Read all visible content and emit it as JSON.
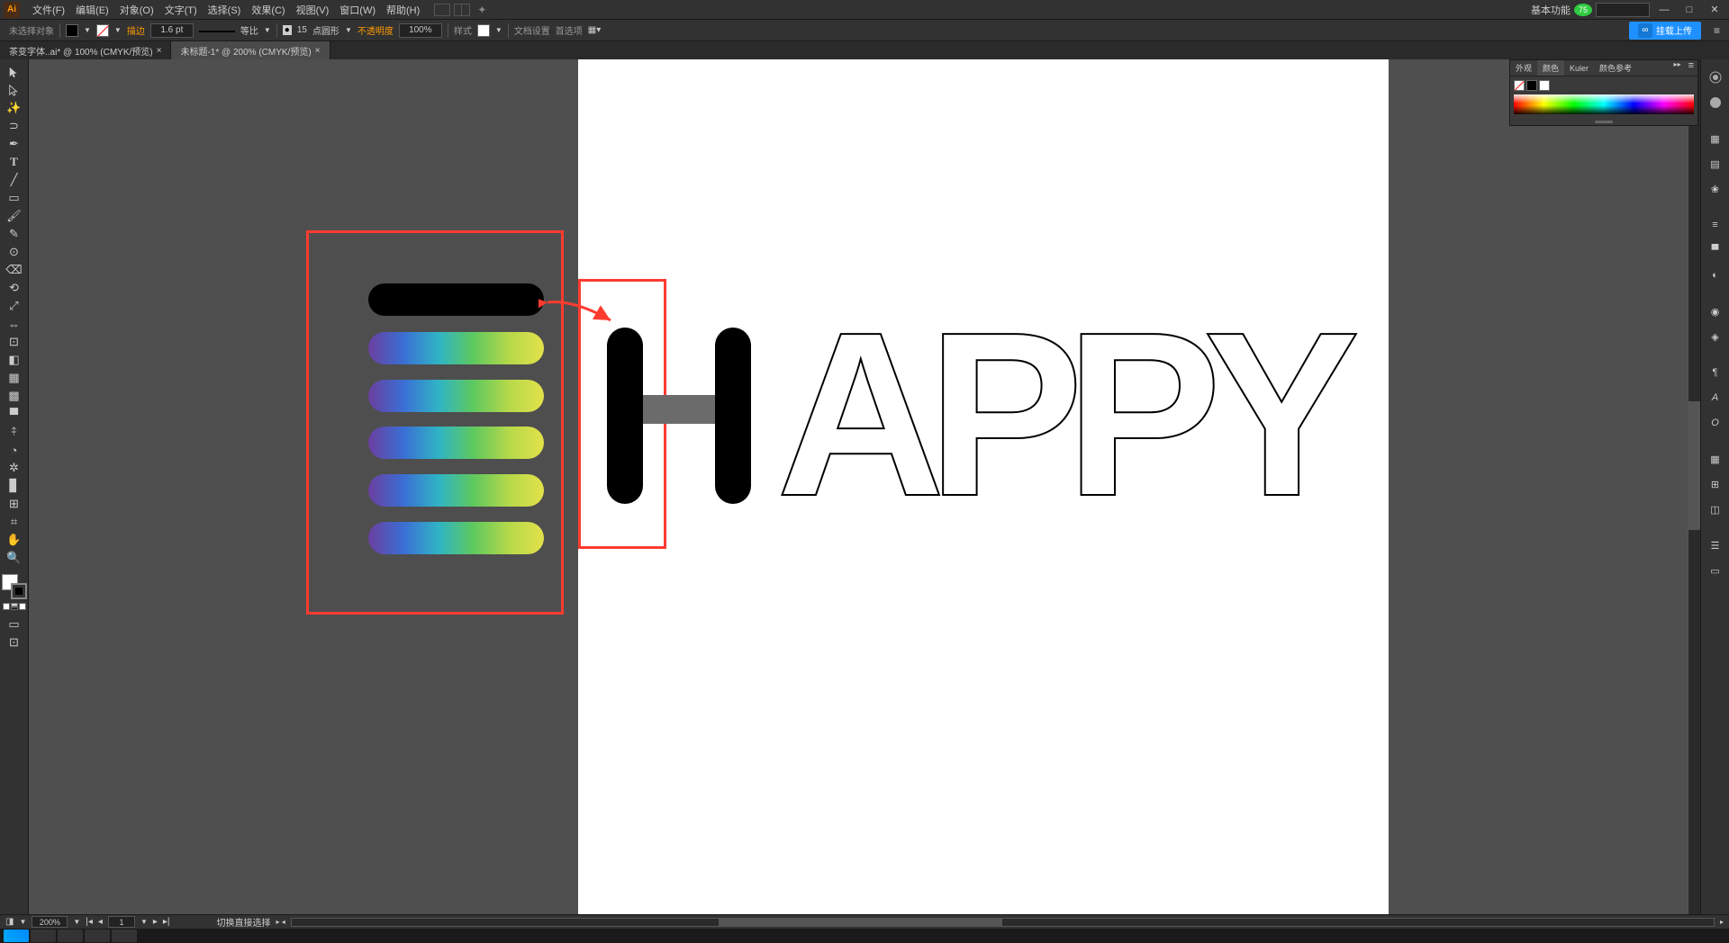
{
  "menubar": {
    "items": [
      "文件(F)",
      "编辑(E)",
      "对象(O)",
      "文字(T)",
      "选择(S)",
      "效果(C)",
      "视图(V)",
      "窗口(W)",
      "帮助(H)"
    ],
    "workspace": "基本功能",
    "badge": "75"
  },
  "controlbar": {
    "selection": "未选择对象",
    "stroke_label": "描边",
    "stroke_weight": "1.6 pt",
    "stroke_style": "等比",
    "brush_size": "15",
    "brush_label": "点圆形",
    "opacity_label": "不透明度",
    "opacity": "100%",
    "style_label": "样式",
    "docsetup": "文档设置",
    "prefs": "首选项",
    "upload": "挂载上传"
  },
  "tabs": [
    {
      "label": "茶变字体..ai* @ 100% (CMYK/预览)",
      "active": false
    },
    {
      "label": "未标题-1* @ 200% (CMYK/预览)",
      "active": true
    }
  ],
  "colorpanel": {
    "tabs": [
      "外观",
      "颜色",
      "Kuler",
      "颜色参考"
    ]
  },
  "canvas": {
    "outline_text": "APPY"
  },
  "status": {
    "zoom": "200%",
    "page": "1",
    "tool": "切换直接选择"
  }
}
